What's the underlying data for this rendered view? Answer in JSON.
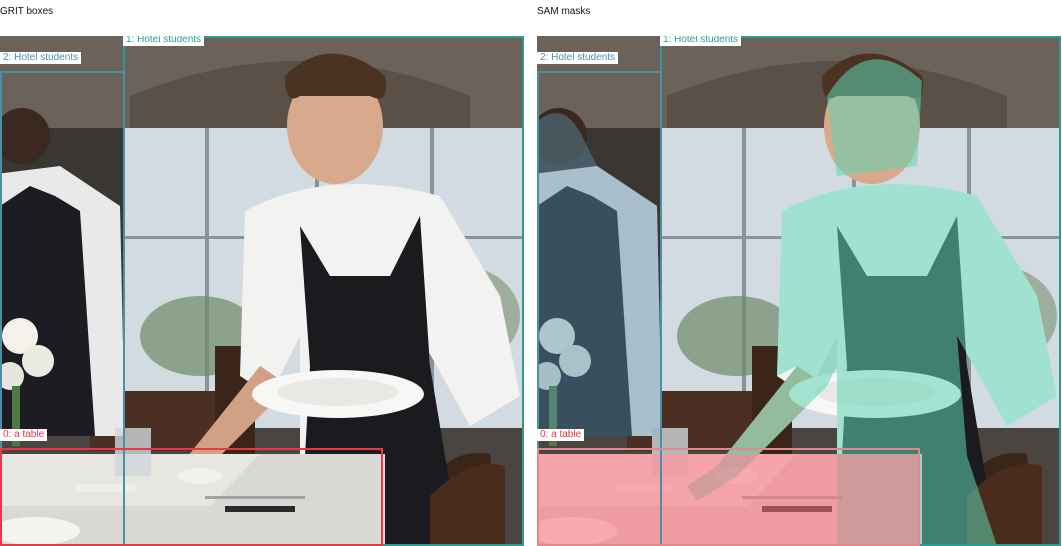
{
  "panels": [
    {
      "title": "GRIT boxes"
    },
    {
      "title": "SAM masks"
    }
  ],
  "detections": [
    {
      "label": "1: Hotel students",
      "color": "#2a9d8f"
    },
    {
      "label": "2: Hotel students",
      "color": "#4a8fa8"
    },
    {
      "label": "0: a table",
      "color": "#e63946"
    }
  ],
  "mask_colors": {
    "person_main": "#5fd3b4",
    "person_side": "#5b8fa8",
    "table": "#ff6b7a"
  }
}
